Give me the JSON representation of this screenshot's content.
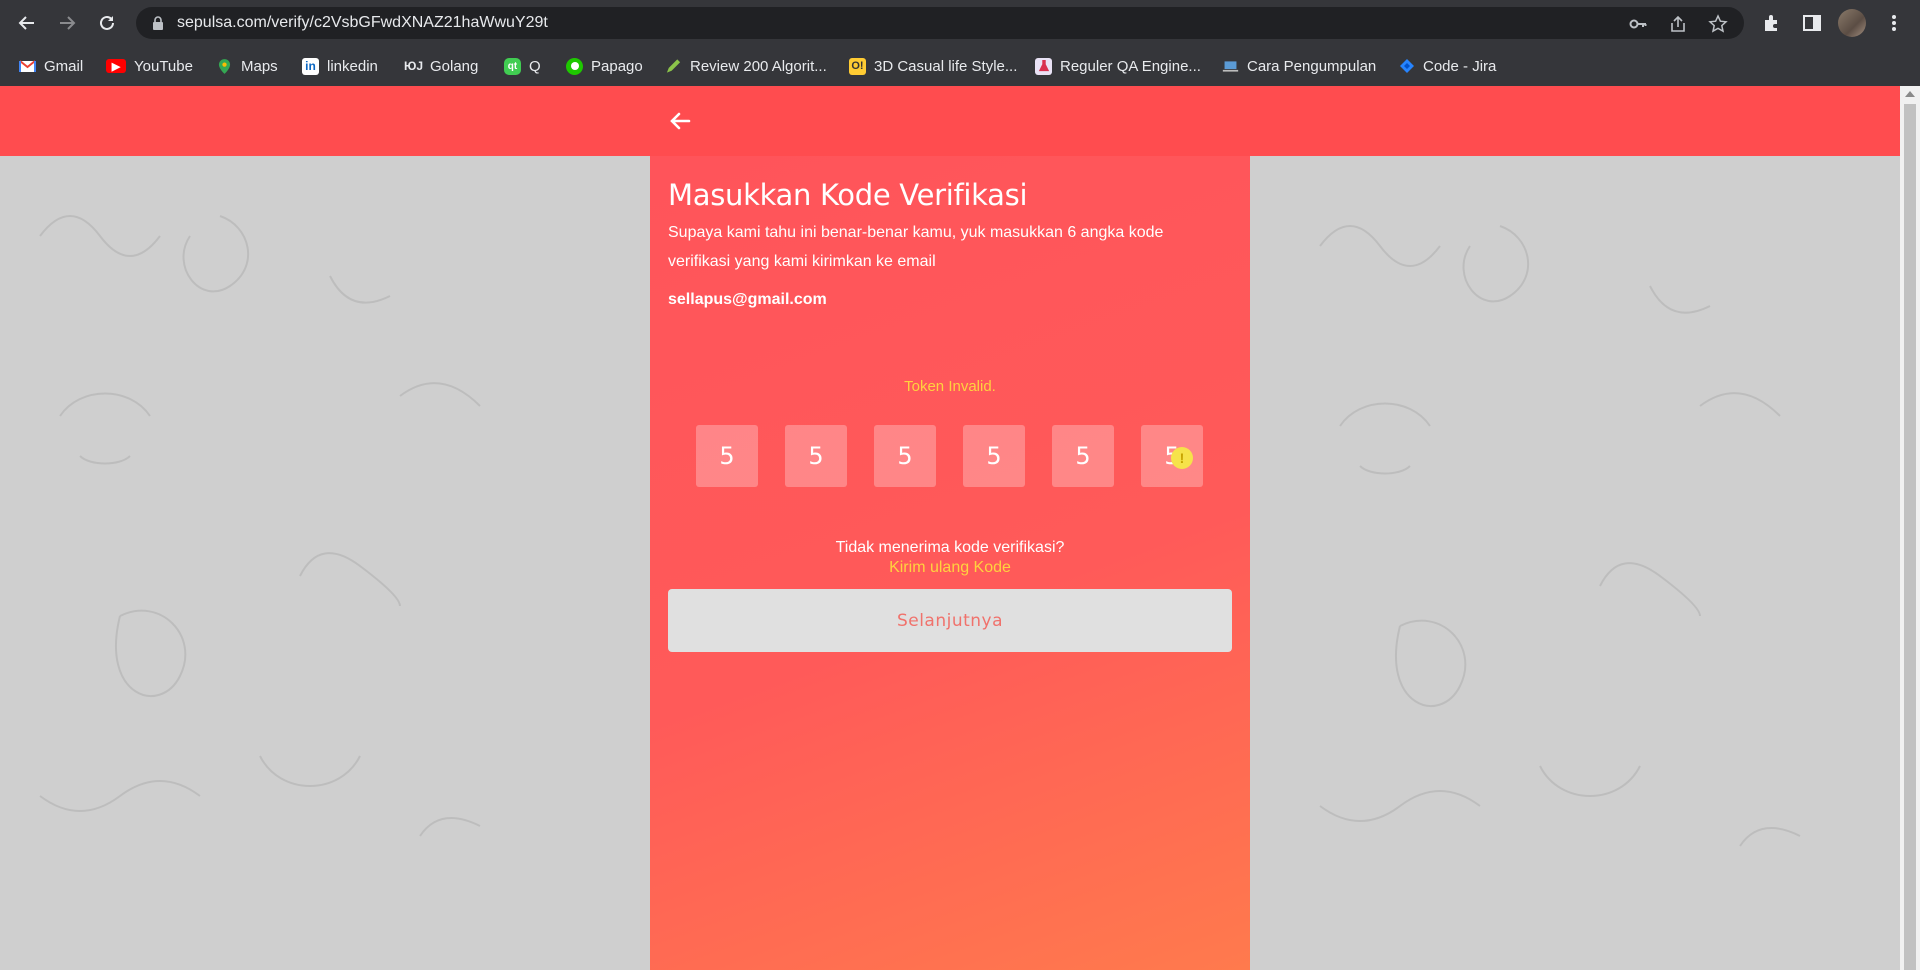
{
  "browser": {
    "url": "sepulsa.com/verify/c2VsbGFwdXNAZ21haWwuY29t",
    "bookmarks": [
      {
        "label": "Gmail",
        "icon": "gmail-icon"
      },
      {
        "label": "YouTube",
        "icon": "youtube-icon"
      },
      {
        "label": "Maps",
        "icon": "maps-icon"
      },
      {
        "label": "linkedin",
        "icon": "linkedin-icon"
      },
      {
        "label": "Golang",
        "icon": "golang-icon"
      },
      {
        "label": "Q",
        "icon": "qt-icon"
      },
      {
        "label": "Papago",
        "icon": "papago-icon"
      },
      {
        "label": "Review 200 Algorit...",
        "icon": "pencil-icon"
      },
      {
        "label": "3D Casual life Style...",
        "icon": "o-icon"
      },
      {
        "label": "Reguler QA Engine...",
        "icon": "flask-icon"
      },
      {
        "label": "Cara Pengumpulan",
        "icon": "laptop-icon"
      },
      {
        "label": "Code - Jira",
        "icon": "jira-icon"
      }
    ]
  },
  "verify": {
    "title": "Masukkan Kode Verifikasi",
    "description": "Supaya kami tahu ini benar-benar kamu, yuk masukkan 6 angka kode verifikasi yang kami kirimkan ke email",
    "email": "sellapus@gmail.com",
    "error": "Token Invalid.",
    "code_digits": [
      "5",
      "5",
      "5",
      "5",
      "5",
      "5"
    ],
    "no_code_text": "Tidak menerima kode verifikasi?",
    "resend_label": "Kirim ulang Kode",
    "next_label": "Selanjutnya"
  },
  "colors": {
    "brand_red": "#ff4c4f",
    "warning_yellow": "#ffd23f"
  }
}
